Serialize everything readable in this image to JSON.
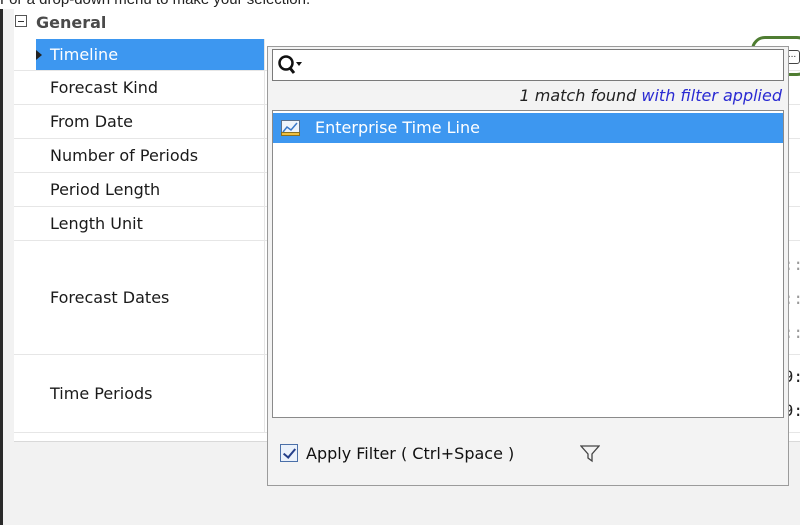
{
  "caption": "For a drop-down menu to make your selection.",
  "group": {
    "title": "General",
    "expanded": true
  },
  "properties": [
    {
      "name": "Timeline",
      "selected": true,
      "value": "Enterprise Time Line",
      "icon": "timeline-icon"
    },
    {
      "name": "Forecast Kind"
    },
    {
      "name": "From Date"
    },
    {
      "name": "Number of Periods"
    },
    {
      "name": "Period Length"
    },
    {
      "name": "Length Unit"
    },
    {
      "name": "Forecast Dates"
    },
    {
      "name": "Time Periods"
    }
  ],
  "controls": {
    "dropdown_icon": "chevron-down-icon",
    "more_label": "..."
  },
  "edge_fragments": {
    "forecast": [
      "::",
      "::",
      "::"
    ],
    "time": [
      "9:",
      "9:"
    ]
  },
  "popup": {
    "search": {
      "value": "",
      "placeholder": "",
      "icon": "search-icon"
    },
    "match": {
      "count_text": "1 match found",
      "filter_text": "with filter applied"
    },
    "results": [
      {
        "label": "Enterprise Time Line",
        "selected": true,
        "icon": "timeline-icon"
      }
    ],
    "apply_filter": {
      "label": "Apply Filter ( Ctrl+Space )",
      "checked": true,
      "icon": "funnel-icon"
    }
  },
  "colors": {
    "selection": "#3d97f0",
    "highlight_ring": "#4f7d32",
    "filter_link": "#2a2ad2"
  }
}
